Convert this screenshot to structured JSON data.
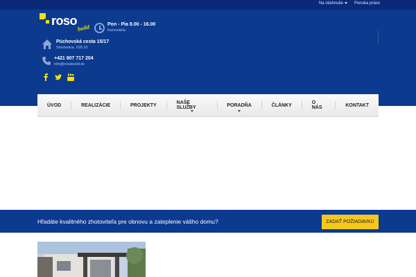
{
  "topbar": {
    "links": [
      "Na stiahnutie",
      "Ponuka práce"
    ]
  },
  "logo": {
    "brand": "roso",
    "sub": "build"
  },
  "contact": {
    "hours_title": "Pon - Pia 8.00 - 16.00",
    "hours_sub": "Kancelária",
    "address_title": "Púchovská cesta 15/17",
    "address_sub": "Streženice, 020 01",
    "phone_title": "+421 907 717 204",
    "phone_sub": "info@rosobuild.sk"
  },
  "social": [
    "facebook-icon",
    "twitter-icon",
    "youtube-icon"
  ],
  "nav": {
    "items": [
      "ÚVOD",
      "REALIZÁCIE",
      "PROJEKTY",
      "NAŠE SLUŽBY",
      "PORADŇA",
      "ČLÁNKY",
      "O NÁS",
      "KONTAKT"
    ]
  },
  "cta": {
    "text": "Hľadáte kvalitného zhotoviteľa pre obnovu a zateplenie vášho domu?",
    "button": "ZADAŤ POŽIADAVKU"
  },
  "colors": {
    "brand_blue": "#0b3a8f",
    "top_bar": "#0a2a77",
    "accent_yellow": "#f6c81e",
    "logo_yellow": "#f6e100"
  }
}
